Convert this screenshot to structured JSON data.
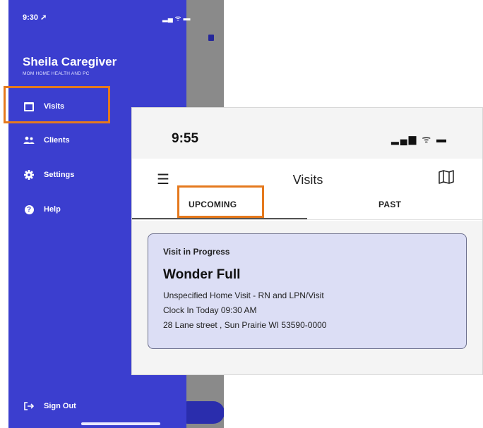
{
  "drawer": {
    "status_time": "9:30 ➚",
    "status_icons": "▂▄ ᯤ ▬",
    "user_name": "Sheila Caregiver",
    "org_name": "MOM HOME HEALTH AND PC",
    "items": [
      {
        "label": "Visits",
        "icon": "calendar-icon"
      },
      {
        "label": "Clients",
        "icon": "people-icon"
      },
      {
        "label": "Settings",
        "icon": "gear-icon"
      },
      {
        "label": "Help",
        "icon": "help-icon",
        "glyph": "?"
      }
    ],
    "sign_out": "Sign Out",
    "accent": "#3b3ecf"
  },
  "visits_screen": {
    "status_time": "9:55",
    "status_icons": "▂▄▆ ᯤ ▬",
    "title": "Visits",
    "tabs": [
      {
        "label": "UPCOMING",
        "selected": true
      },
      {
        "label": "PAST",
        "selected": false
      }
    ],
    "card": {
      "status": "Visit in Progress",
      "client": "Wonder Full",
      "service": "Unspecified Home Visit - RN and LPN/Visit",
      "clock_in": "Clock In Today 09:30 AM",
      "address": "28 Lane street , Sun Prairie WI 53590-0000"
    }
  },
  "highlight_color": "#e5791d"
}
